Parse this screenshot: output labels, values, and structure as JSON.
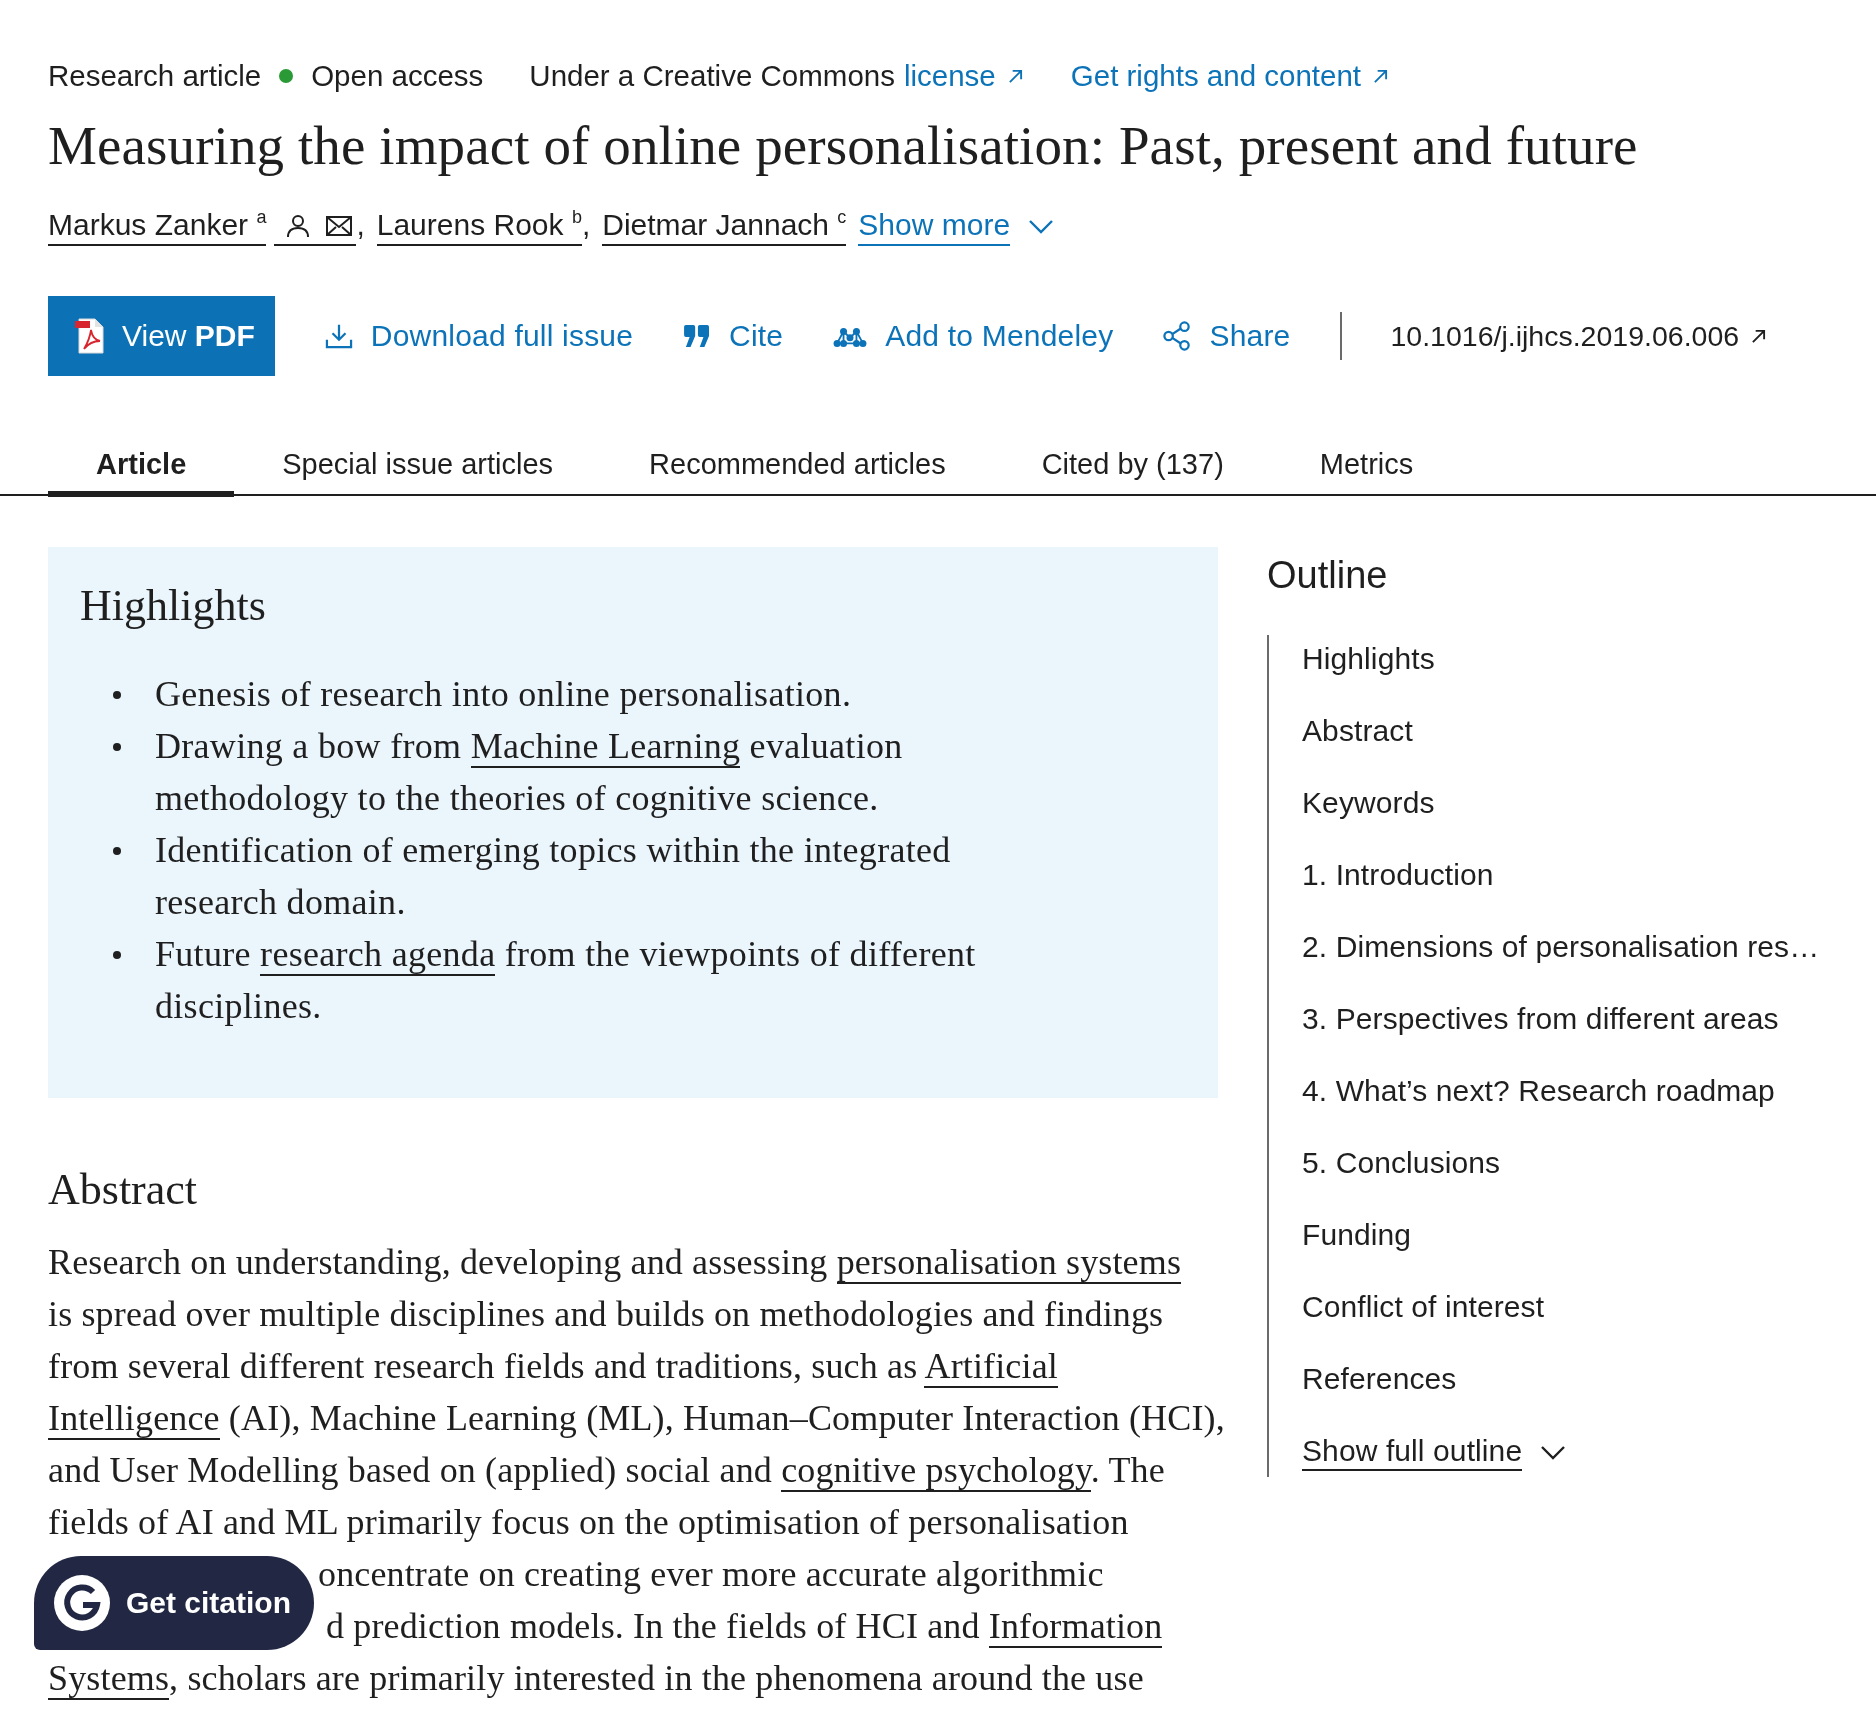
{
  "meta": {
    "article_type": "Research article",
    "access": "Open access",
    "license_text": "Under a Creative Commons",
    "license_link": "license",
    "rights_link": "Get rights and content"
  },
  "title": "Measuring the impact of online personalisation: Past, present and future",
  "authors": [
    {
      "name": "Markus Zanker",
      "affiliation": "a",
      "contact_icons": true,
      "separator": ","
    },
    {
      "name": "Laurens Rook",
      "affiliation": "b",
      "contact_icons": false,
      "separator": ","
    },
    {
      "name": "Dietmar Jannach",
      "affiliation": "c",
      "contact_icons": false
    }
  ],
  "show_more": "Show more",
  "actions": {
    "view_pdf": "View **PDF**",
    "links": [
      {
        "label": "Download full issue"
      },
      {
        "label": "Cite"
      },
      {
        "label": "Add to Mendeley"
      },
      {
        "label": "Share"
      }
    ],
    "doi": "10.1016/j.ijhcs.2019.06.006"
  },
  "tabs": [
    {
      "label": "Article",
      "selected": true
    },
    {
      "label": "Special issue articles",
      "selected": false
    },
    {
      "label": "Recommended articles",
      "selected": false
    },
    {
      "label": "Cited by (137)",
      "selected": false
    },
    {
      "label": "Metrics",
      "selected": false
    }
  ],
  "highlights": {
    "heading": "Highlights",
    "items": [
      [
        {
          "kind": "text",
          "text": "Genesis of research into online personalisation."
        }
      ],
      [
        {
          "kind": "text",
          "text": "Drawing a bow from "
        },
        {
          "kind": "link",
          "text": "Machine Learning"
        },
        {
          "kind": "text",
          "text": " evaluation methodology to the theories of cognitive science."
        }
      ],
      [
        {
          "kind": "text",
          "text": "Identification of emerging topics within the integrated research domain."
        }
      ],
      [
        {
          "kind": "text",
          "text": "Future "
        },
        {
          "kind": "link",
          "text": "research agenda"
        },
        {
          "kind": "text",
          "text": " from the viewpoints of different disciplines."
        }
      ]
    ]
  },
  "abstract": {
    "heading": "Abstract",
    "fragments": [
      [
        {
          "kind": "text",
          "text": "Research on understanding, developing and assessing "
        },
        {
          "kind": "link",
          "text": "personalisation systems"
        },
        {
          "kind": "text",
          "text": "\nis spread over multiple disciplines and builds on methodologies and findings\nfrom several different research fields and traditions, such as "
        },
        {
          "kind": "link",
          "text": "Artificial\n"
        },
        {
          "kind": "link",
          "text": "Intelligence"
        },
        {
          "kind": "text",
          "text": " (AI), Machine Learning (ML), Human–Computer Interaction (HCI),\nand User Modelling based on (applied) social and "
        },
        {
          "kind": "link",
          "text": "cognitive psychology"
        },
        {
          "kind": "text",
          "text": ". The\nfields of AI and ML primarily focus on the optimisation of personalisation"
        }
      ],
      [
        {
          "kind": "text",
          "text": "oncentrate on creating ever more accurate algorithmic"
        }
      ],
      [
        {
          "kind": "text",
          "text": "d prediction models. In the fields of HCI and "
        },
        {
          "kind": "link",
          "text": "Information"
        }
      ],
      [
        {
          "kind": "link",
          "text": "Systems"
        },
        {
          "kind": "text",
          "text": ", scholars are primarily interested in the phenomena around the use"
        }
      ]
    ]
  },
  "outline": {
    "heading": "Outline",
    "items": [
      "Highlights",
      "Abstract",
      "Keywords",
      "1. Introduction",
      "2. Dimensions of personalisation res…",
      "3. Perspectives from different areas",
      "4. What’s next? Research roadmap",
      "5. Conclusions",
      "Funding",
      "Conflict of interest",
      "References"
    ],
    "show_full": "Show full outline"
  },
  "get_citation": {
    "label": "Get citation"
  }
}
